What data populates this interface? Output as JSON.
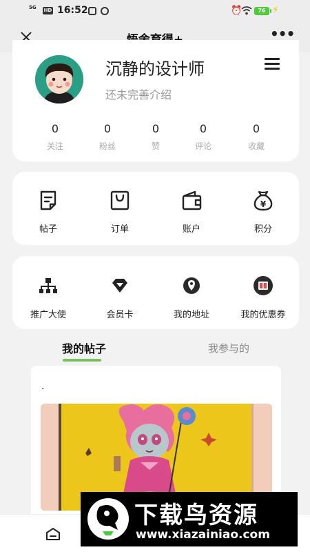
{
  "status_bar": {
    "signal": "5G",
    "network_badge": "HD",
    "time": "16:52",
    "battery": "76"
  },
  "nav": {
    "title": "悟舍育得+"
  },
  "profile": {
    "username": "沉静的设计师",
    "bio": "还未完善介绍",
    "stats": [
      {
        "value": "0",
        "label": "关注"
      },
      {
        "value": "0",
        "label": "粉丝"
      },
      {
        "value": "0",
        "label": "赞"
      },
      {
        "value": "0",
        "label": "评论"
      },
      {
        "value": "0",
        "label": "收藏"
      }
    ]
  },
  "quick_menu": [
    {
      "label": "帖子",
      "icon": "post-icon"
    },
    {
      "label": "订单",
      "icon": "shopping-bag-icon"
    },
    {
      "label": "账户",
      "icon": "wallet-icon"
    },
    {
      "label": "积分",
      "icon": "money-bag-icon"
    }
  ],
  "service_menu": [
    {
      "label": "推广大使",
      "icon": "org-chart-icon"
    },
    {
      "label": "会员卡",
      "icon": "diamond-icon"
    },
    {
      "label": "我的地址",
      "icon": "location-pin-icon"
    },
    {
      "label": "我的优惠券",
      "icon": "coupon-icon"
    }
  ],
  "tabs": [
    {
      "label": "我的帖子",
      "active": true
    },
    {
      "label": "我参与的",
      "active": false
    }
  ],
  "post": {
    "text": "."
  },
  "watermark": {
    "title": "下载鸟资源",
    "url": "www.xiazainiao.com"
  },
  "colors": {
    "accent": "#7dc15f",
    "avatar_bg": "#2a9f86",
    "battery": "#4ecb3d"
  }
}
